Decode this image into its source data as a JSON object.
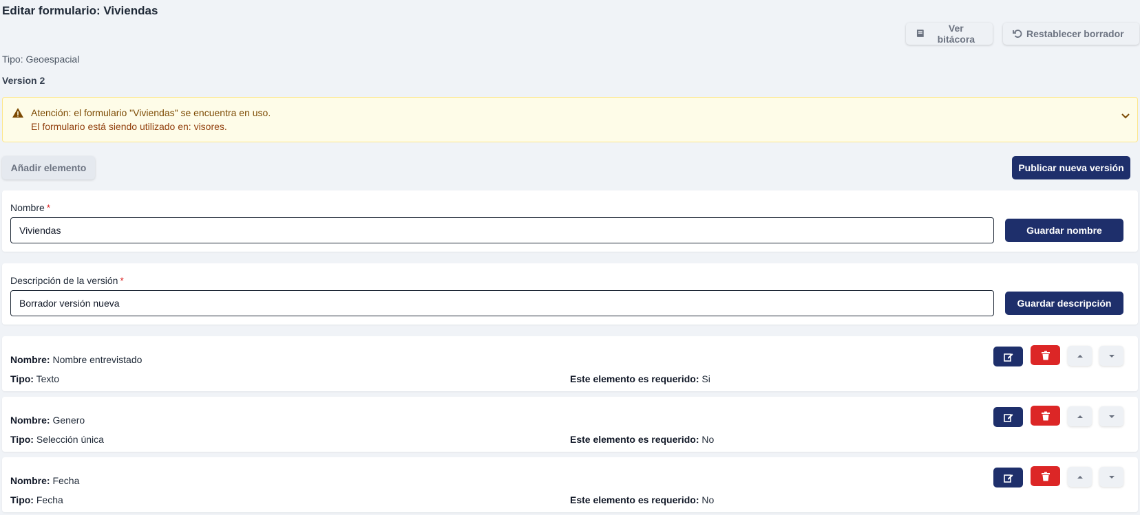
{
  "header": {
    "title": "Editar formulario: Viviendas",
    "log_button": "Ver bitácora",
    "reset_button": "Restablecer borrador"
  },
  "meta": {
    "type_label": "Tipo:",
    "type_value": "Geoespacial",
    "version": "Version 2"
  },
  "alert": {
    "line1": "Atención: el formulario \"Viviendas\" se encuentra en uso.",
    "line2": "El formulario está siendo utilizado en: visores."
  },
  "toolbar": {
    "add_label": "Añadir elemento",
    "publish_label": "Publicar nueva versión"
  },
  "name_form": {
    "label": "Nombre",
    "required_mark": "*",
    "value": "Viviendas",
    "save_label": "Guardar nombre"
  },
  "desc_form": {
    "label": "Descripción de la versión",
    "required_mark": "*",
    "value": "Borrador versión nueva",
    "save_label": "Guardar descripción"
  },
  "element_labels": {
    "name": "Nombre:",
    "type": "Tipo:",
    "required": "Este elemento es requerido:"
  },
  "elements": [
    {
      "name": "Nombre entrevistado",
      "type": "Texto",
      "required": "Si"
    },
    {
      "name": "Genero",
      "type": "Selección única",
      "required": "No"
    },
    {
      "name": "Fecha",
      "type": "Fecha",
      "required": "No"
    }
  ],
  "colors": {
    "primary": "#1e2f6b",
    "danger": "#dc2626",
    "warning_bg": "#fefce8",
    "warning_text": "#92400e",
    "page_bg": "#f0f3f7"
  }
}
